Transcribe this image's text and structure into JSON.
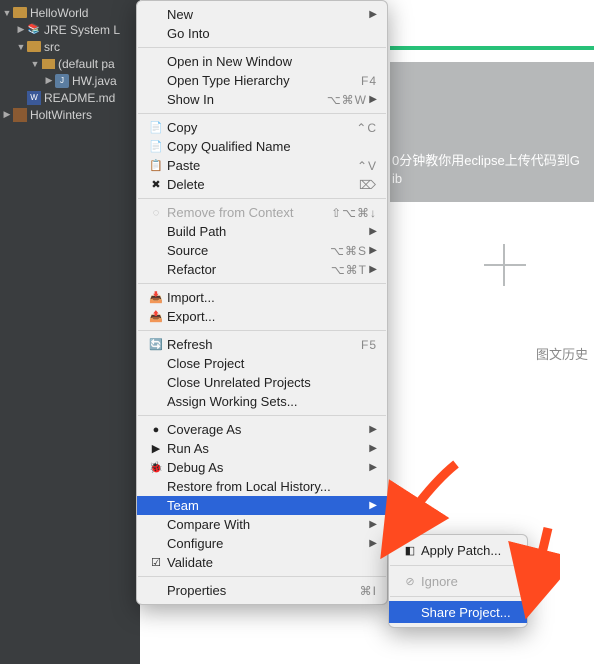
{
  "sidebar": {
    "items": [
      {
        "label": "HelloWorld",
        "icon": "folder"
      },
      {
        "label": "JRE System L",
        "icon": "library"
      },
      {
        "label": "src",
        "icon": "folder"
      },
      {
        "label": "(default pa",
        "icon": "package"
      },
      {
        "label": "HW.java",
        "icon": "java"
      },
      {
        "label": "README.md",
        "icon": "md"
      },
      {
        "label": "HoltWinters",
        "icon": "project"
      }
    ]
  },
  "content": {
    "box_line1": "0分钟教你用eclipse上传代码到G",
    "box_line2": "ib",
    "footer": "图文历史"
  },
  "menu": {
    "items": [
      {
        "label": "New",
        "submenu": true
      },
      {
        "label": "Go Into"
      },
      {
        "sep": true
      },
      {
        "label": "Open in New Window"
      },
      {
        "label": "Open Type Hierarchy",
        "shortcut": "F4"
      },
      {
        "label": "Show In",
        "shortcut": "⌥⌘W",
        "submenu": true
      },
      {
        "sep": true
      },
      {
        "icon": "copy",
        "label": "Copy",
        "shortcut": "⌃C"
      },
      {
        "icon": "copy",
        "label": "Copy Qualified Name"
      },
      {
        "icon": "paste",
        "label": "Paste",
        "shortcut": "⌃V"
      },
      {
        "icon": "delete",
        "label": "Delete",
        "shortcut": "⌦"
      },
      {
        "sep": true
      },
      {
        "icon": "context",
        "label": "Remove from Context",
        "shortcut": "⇧⌥⌘↓",
        "disabled": true
      },
      {
        "label": "Build Path",
        "submenu": true
      },
      {
        "label": "Source",
        "shortcut": "⌥⌘S",
        "submenu": true
      },
      {
        "label": "Refactor",
        "shortcut": "⌥⌘T",
        "submenu": true
      },
      {
        "sep": true
      },
      {
        "icon": "import",
        "label": "Import..."
      },
      {
        "icon": "export",
        "label": "Export..."
      },
      {
        "sep": true
      },
      {
        "icon": "refresh",
        "label": "Refresh",
        "shortcut": "F5"
      },
      {
        "label": "Close Project"
      },
      {
        "label": "Close Unrelated Projects"
      },
      {
        "label": "Assign Working Sets..."
      },
      {
        "sep": true
      },
      {
        "icon": "coverage",
        "label": "Coverage As",
        "submenu": true
      },
      {
        "icon": "run",
        "label": "Run As",
        "submenu": true
      },
      {
        "icon": "debug",
        "label": "Debug As",
        "submenu": true
      },
      {
        "label": "Restore from Local History..."
      },
      {
        "label": "Team",
        "submenu": true,
        "highlight": true
      },
      {
        "label": "Compare With",
        "submenu": true
      },
      {
        "label": "Configure",
        "submenu": true
      },
      {
        "icon": "validate",
        "label": "Validate"
      },
      {
        "sep": true
      },
      {
        "label": "Properties",
        "shortcut": "⌘I"
      }
    ]
  },
  "submenu": {
    "items": [
      {
        "label": "Apply Patch...",
        "icon": "patch"
      },
      {
        "sep": true
      },
      {
        "label": "Ignore",
        "icon": "ignore",
        "disabled": true
      },
      {
        "sep": true
      },
      {
        "label": "Share Project...",
        "highlight": true
      }
    ]
  },
  "icons": {
    "copy": "📄",
    "paste": "📋",
    "delete": "✖",
    "import": "📥",
    "export": "📤",
    "refresh": "🔄",
    "coverage": "●",
    "run": "▶",
    "debug": "🐞",
    "validate": "☑",
    "patch": "◧",
    "ignore": "⊘",
    "context": "◌"
  },
  "colors": {
    "highlight": "#2b64d8",
    "arrow": "#ff4a1f"
  }
}
